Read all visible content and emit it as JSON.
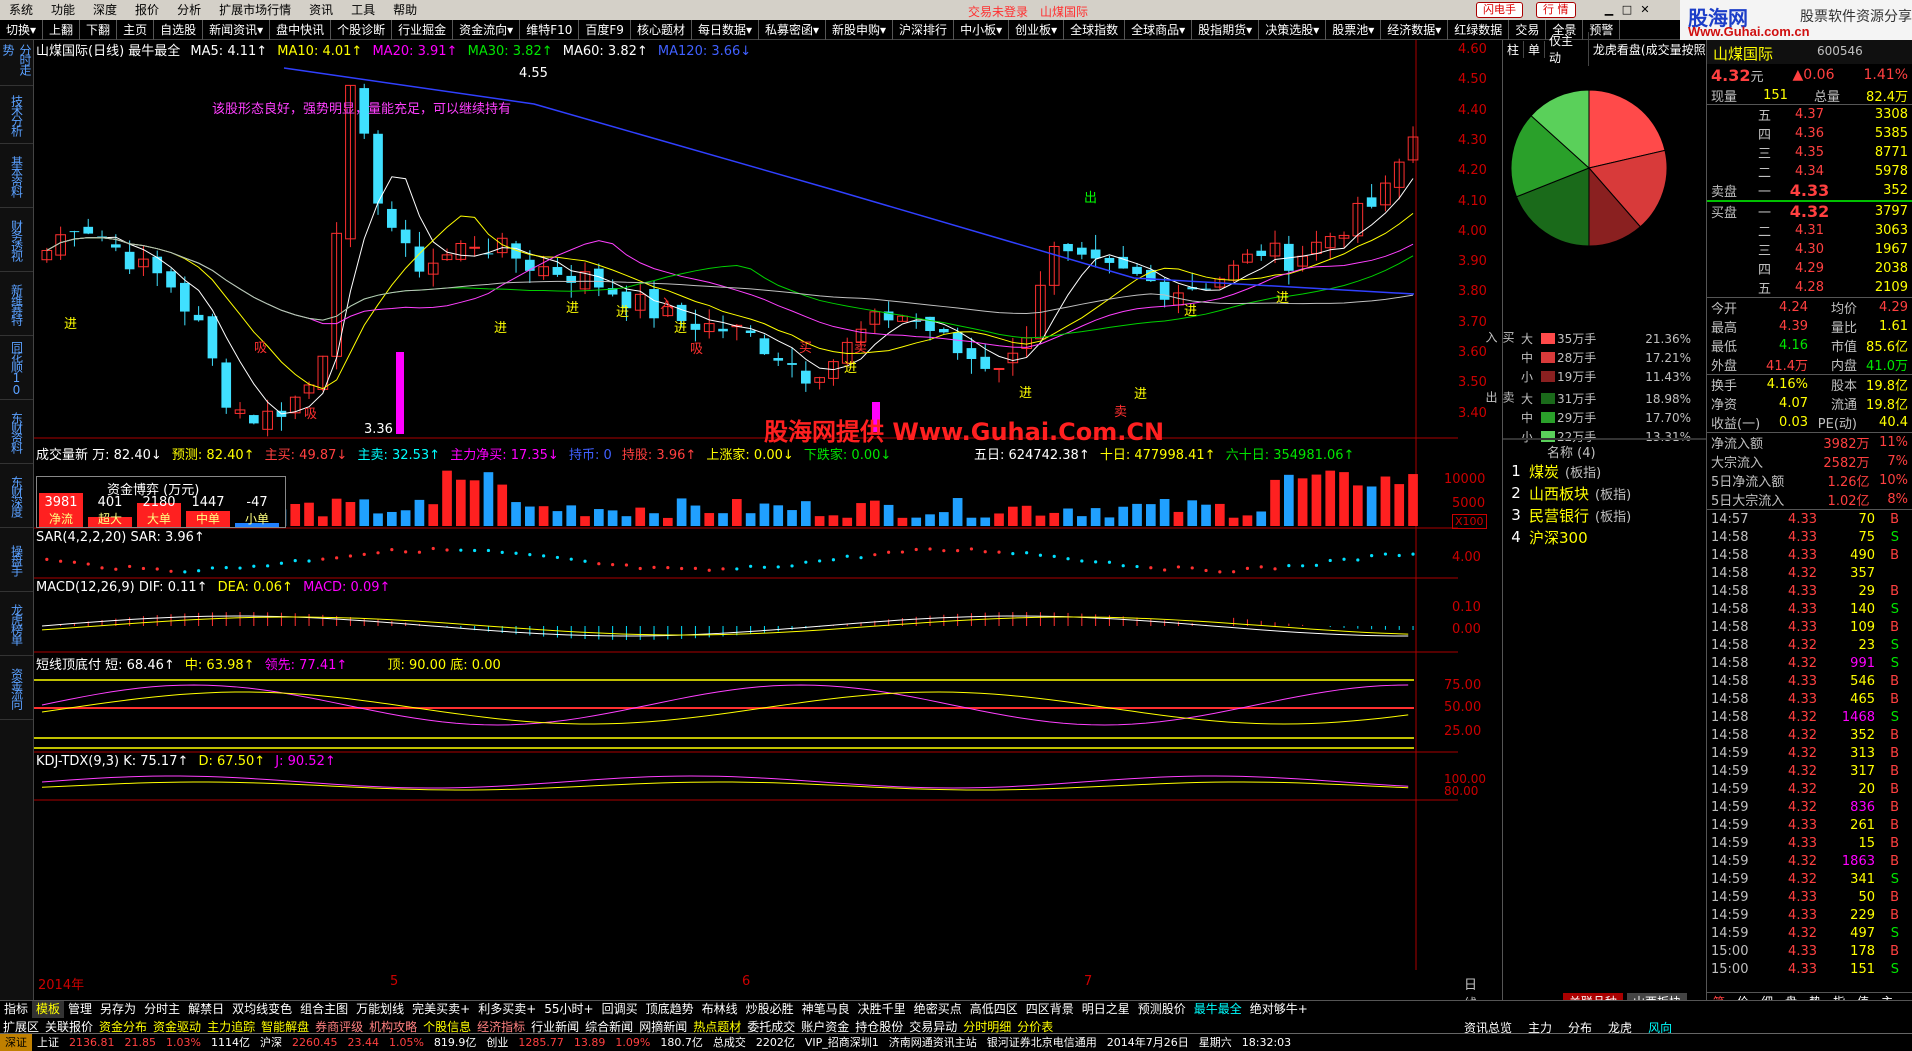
{
  "menu": [
    "系统",
    "功能",
    "深度",
    "报价",
    "分析",
    "扩展市场行情",
    "资讯",
    "工具",
    "帮助"
  ],
  "top_status": {
    "login": "交易未登录",
    "stock": "山煤国际",
    "btn_flash": "闪电手",
    "btn_market": "行 情"
  },
  "logo": {
    "main": "股海网",
    "tagline": "股票软件资源分享",
    "url": "Www.Guhai.com.cn"
  },
  "toolbar": [
    "切换▾",
    "上翻",
    "下翻",
    "主页",
    "自选股",
    "新闻资讯▾",
    "盘中快讯",
    "个股诊断",
    "行业掘金",
    "资金流向▾",
    "维特F10",
    "百度F9",
    "核心题材",
    "每日数据▾",
    "私募密函▾",
    "新股申购▾",
    "沪深排行",
    "中小板▾",
    "创业板▾",
    "全球指数",
    "全球商品▾",
    "股指期货▾",
    "决策选股▾",
    "股票池▾",
    "经济数据▾",
    "红绿数据",
    "交易",
    "全景",
    "预警"
  ],
  "left_tabs": [
    "分时走势",
    "技术分析",
    "基本资料",
    "财务透视",
    "新维赛特",
    "同花顺10",
    "东财资料",
    "东财深度",
    "操盘手",
    "龙虎榜单",
    "资金流向"
  ],
  "left_icons": [
    "ZJ",
    "F10",
    "Fz",
    "Go",
    "RSI",
    "Ch",
    "DP"
  ],
  "main": {
    "header": {
      "title": "山煤国际(日线) 最牛最全",
      "ma5": "MA5: 4.11↑",
      "ma10": "MA10: 4.01↑",
      "ma20": "MA20: 3.91↑",
      "ma30": "MA30: 3.82↑",
      "ma60": "MA60: 3.82↑",
      "ma120": "MA120: 3.66↓"
    },
    "comment": "该股形态良好，强势明显，量能充足，可以继续持有",
    "high_label": "4.55",
    "low_label": "3.36",
    "signals": [
      "进",
      "进",
      "进",
      "进",
      "进",
      "进",
      "进",
      "进",
      "进",
      "进",
      "出",
      "吸",
      "吸",
      "吸",
      "卖",
      "买",
      "卖",
      "入"
    ],
    "watermark": "股海网提供 Www.Guhai.Com.CN",
    "yaxis": [
      "4.60",
      "4.50",
      "4.40",
      "4.30",
      "4.20",
      "4.10",
      "4.00",
      "3.90",
      "3.80",
      "3.70",
      "3.60",
      "3.50",
      "3.40"
    ],
    "xaxis": [
      "2014年",
      "5",
      "6",
      "7"
    ],
    "period": "日线",
    "vol_header": {
      "a": "成交量新 万: 82.40↓",
      "b": "预测: 82.40↑",
      "c": "主买: 49.87↓",
      "d": "主卖: 32.53↑",
      "e": "主力净买: 17.35↓",
      "f": "持币: 0",
      "g": "持股: 3.96↑",
      "h": "上涨家: 0.00↓",
      "i": "下跌家: 0.00↓"
    },
    "vol_header2": {
      "a": "五日: 624742.38↑",
      "b": "十日: 477998.41↑",
      "c": "六十日: 354981.06↑"
    },
    "vol_axis": [
      "10000",
      "5000",
      "X100"
    ],
    "fund_box": {
      "title": "资金博弈 (万元)",
      "vals": [
        "3981",
        "401",
        "2180",
        "1447",
        "-47"
      ],
      "labels": [
        "净流",
        "超大",
        "大单",
        "中单",
        "小单"
      ]
    },
    "sar": {
      "header": "SAR(4,2,2,20) SAR: 3.96↑",
      "axis": "4.00"
    },
    "macd": {
      "header_a": "MACD(12,26,9) DIF: 0.11↑",
      "header_b": "DEA: 0.06↑",
      "header_c": "MACD: 0.09↑",
      "axis": [
        "0.10",
        "0.00"
      ]
    },
    "short": {
      "header_a": "短线顶底付 短: 68.46↑",
      "header_b": "中: 63.98↑",
      "header_c": "领先: 77.41↑",
      "header_d": "顶: 90.00 底: 0.00",
      "axis": [
        "75.00",
        "50.00",
        "25.00"
      ]
    },
    "kdj": {
      "header_a": "KDJ-TDX(9,3) K: 75.17↑",
      "header_b": "D: 67.50↑",
      "header_c": "J: 90.52↑",
      "axis": [
        "100.00",
        "80.00"
      ]
    }
  },
  "mid": {
    "tabs": [
      "柱",
      "单",
      "仅主动",
      "龙虎看盘(成交量按照"
    ],
    "pie_colors": [
      "#ff4a4a",
      "#d83a3a",
      "#8a2020",
      "#1a6a1a",
      "#2aa02a",
      "#5ad05a"
    ],
    "flow_buy": [
      {
        "k": "大",
        "v": "35万手",
        "p": "21.36%"
      },
      {
        "k": "中",
        "v": "28万手",
        "p": "17.21%"
      },
      {
        "k": "小",
        "v": "19万手",
        "p": "11.43%"
      }
    ],
    "flow_sell": [
      {
        "k": "大",
        "v": "31万手",
        "p": "18.98%"
      },
      {
        "k": "中",
        "v": "29万手",
        "p": "17.70%"
      },
      {
        "k": "小",
        "v": "22万手",
        "p": "13.31%"
      }
    ],
    "side_buy": "买入",
    "side_sell": "卖出",
    "sector_title": "名称 (4)",
    "sectors": [
      {
        "n": "1",
        "name": "煤炭",
        "tag": "(板指)"
      },
      {
        "n": "2",
        "name": "山西板块",
        "tag": "(板指)"
      },
      {
        "n": "3",
        "name": "民营银行",
        "tag": "(板指)"
      },
      {
        "n": "4",
        "name": "沪深300",
        "tag": ""
      }
    ],
    "bottom_tabs": [
      "关联品种",
      "山西板块"
    ]
  },
  "quote": {
    "name": "山煤国际",
    "code": "600546",
    "price": "4.32",
    "unit": "元",
    "change": "▲0.06",
    "pct": "1.41%",
    "xianliang": {
      "l": "现量",
      "v": "151",
      "l2": "总量",
      "v2": "82.4万"
    },
    "asks": [
      {
        "l": "五",
        "p": "4.37",
        "v": "3308"
      },
      {
        "l": "四",
        "p": "4.36",
        "v": "5385"
      },
      {
        "l": "三",
        "p": "4.35",
        "v": "8771"
      },
      {
        "l": "二",
        "p": "4.34",
        "v": "5978"
      },
      {
        "l": "一",
        "p": "4.33",
        "v": "352"
      }
    ],
    "ask_label": "卖盘",
    "bid_label": "买盘",
    "bids": [
      {
        "l": "一",
        "p": "4.32",
        "v": "3797"
      },
      {
        "l": "二",
        "p": "4.31",
        "v": "3063"
      },
      {
        "l": "三",
        "p": "4.30",
        "v": "1967"
      },
      {
        "l": "四",
        "p": "4.29",
        "v": "2038"
      },
      {
        "l": "五",
        "p": "4.28",
        "v": "2109"
      }
    ],
    "stats": [
      {
        "a": "今开",
        "b": "4.24",
        "c": "均价",
        "d": "4.29"
      },
      {
        "a": "最高",
        "b": "4.39",
        "c": "量比",
        "d": "1.61"
      },
      {
        "a": "最低",
        "b": "4.16",
        "c": "市值",
        "d": "85.6亿"
      },
      {
        "a": "外盘",
        "b": "41.4万",
        "c": "内盘",
        "d": "41.0万"
      }
    ],
    "stats2": [
      {
        "a": "换手",
        "b": "4.16%",
        "c": "股本",
        "d": "19.8亿"
      },
      {
        "a": "净资",
        "b": "4.07",
        "c": "流通",
        "d": "19.8亿"
      },
      {
        "a": "收益(一)",
        "b": "0.03",
        "c": "PE(动)",
        "d": "40.4"
      }
    ],
    "flows": [
      {
        "a": "净流入额",
        "b": "3982万",
        "c": "11%"
      },
      {
        "a": "大宗流入",
        "b": "2582万",
        "c": "7%"
      },
      {
        "a": "5日净流入额",
        "b": "1.26亿",
        "c": "10%"
      },
      {
        "a": "5日大宗流入",
        "b": "1.02亿",
        "c": "8%"
      }
    ],
    "ticks": [
      {
        "t": "14:57",
        "p": "4.33",
        "v": "70",
        "s": "B"
      },
      {
        "t": "14:58",
        "p": "4.33",
        "v": "75",
        "s": "S"
      },
      {
        "t": "14:58",
        "p": "4.33",
        "v": "490",
        "s": "B"
      },
      {
        "t": "14:58",
        "p": "4.32",
        "v": "357",
        "s": ""
      },
      {
        "t": "14:58",
        "p": "4.33",
        "v": "29",
        "s": "B"
      },
      {
        "t": "14:58",
        "p": "4.33",
        "v": "140",
        "s": "S"
      },
      {
        "t": "14:58",
        "p": "4.33",
        "v": "109",
        "s": "B"
      },
      {
        "t": "14:58",
        "p": "4.32",
        "v": "23",
        "s": "S"
      },
      {
        "t": "14:58",
        "p": "4.32",
        "v": "991",
        "s": "S"
      },
      {
        "t": "14:58",
        "p": "4.33",
        "v": "546",
        "s": "B"
      },
      {
        "t": "14:58",
        "p": "4.33",
        "v": "465",
        "s": "B"
      },
      {
        "t": "14:58",
        "p": "4.32",
        "v": "1468",
        "s": "S"
      },
      {
        "t": "14:58",
        "p": "4.32",
        "v": "352",
        "s": "B"
      },
      {
        "t": "14:59",
        "p": "4.32",
        "v": "313",
        "s": "B"
      },
      {
        "t": "14:59",
        "p": "4.32",
        "v": "317",
        "s": "B"
      },
      {
        "t": "14:59",
        "p": "4.32",
        "v": "20",
        "s": "B"
      },
      {
        "t": "14:59",
        "p": "4.32",
        "v": "836",
        "s": "B"
      },
      {
        "t": "14:59",
        "p": "4.33",
        "v": "261",
        "s": "B"
      },
      {
        "t": "14:59",
        "p": "4.33",
        "v": "15",
        "s": "B"
      },
      {
        "t": "14:59",
        "p": "4.32",
        "v": "1863",
        "s": "B"
      },
      {
        "t": "14:59",
        "p": "4.32",
        "v": "341",
        "s": "S"
      },
      {
        "t": "14:59",
        "p": "4.33",
        "v": "50",
        "s": "B"
      },
      {
        "t": "14:59",
        "p": "4.33",
        "v": "229",
        "s": "B"
      },
      {
        "t": "14:59",
        "p": "4.32",
        "v": "497",
        "s": "S"
      },
      {
        "t": "15:00",
        "p": "4.33",
        "v": "178",
        "s": "B"
      },
      {
        "t": "15:00",
        "p": "4.33",
        "v": "151",
        "s": "S"
      }
    ],
    "bottom_tabs": [
      "笔",
      "价",
      "细",
      "盘",
      "势",
      "指",
      "值",
      "主"
    ]
  },
  "bottom1": [
    "指标",
    "模板",
    "管理",
    "另存为",
    "分时主",
    "解禁日",
    "双均线变色",
    "组合主图",
    "万能划线",
    "完美买卖+",
    "利多买卖+",
    "55小时+",
    "回调买",
    "顶底趋势",
    "布林线",
    "炒股必胜",
    "神笔马良",
    "决胜千里",
    "绝密买点",
    "高低四区",
    "四区背景",
    "明日之星",
    "预测股价",
    "最牛最全",
    "绝对够牛+"
  ],
  "bottom2": [
    "扩展区",
    "关联报价",
    "资金分布",
    "资金驱动",
    "主力追踪",
    "智能解盘",
    "券商评级",
    "机构攻略",
    "个股信息",
    "经济指标",
    "行业新闻",
    "综合新闻",
    "网摘新闻",
    "热点题材",
    "委托成交",
    "账户资金",
    "持仓股份",
    "交易异动",
    "分时明细",
    "分价表"
  ],
  "bottom_mid": [
    "资讯总览",
    "主力",
    "分布",
    "龙虎",
    "风向"
  ],
  "status": {
    "a": "深证",
    "b": "上证",
    "c": "2136.81",
    "d": "21.85",
    "e": "1.03%",
    "f": "1114亿",
    "g": "沪深",
    "h": "2260.45",
    "i": "23.44",
    "j": "1.05%",
    "k": "819.9亿",
    "l": "创业",
    "m": "1285.77",
    "n": "13.89",
    "o": "1.09%",
    "p": "180.7亿",
    "q": "总成交",
    "r": "2202亿",
    "s": "VIP_招商深圳1",
    "t": "济南网通资讯主站",
    "u": "银河证券北京电信通用",
    "v": "2014年7月26日",
    "w": "星期六",
    "x": "18:32:03"
  },
  "chart_data": {
    "type": "candlestick",
    "title": "山煤国际(日线)",
    "ylim": [
      3.36,
      4.6
    ],
    "high": 4.55,
    "low": 3.36,
    "ma": {
      "MA5": 4.11,
      "MA10": 4.01,
      "MA20": 3.91,
      "MA30": 3.82,
      "MA60": 3.82,
      "MA120": 3.66
    }
  }
}
